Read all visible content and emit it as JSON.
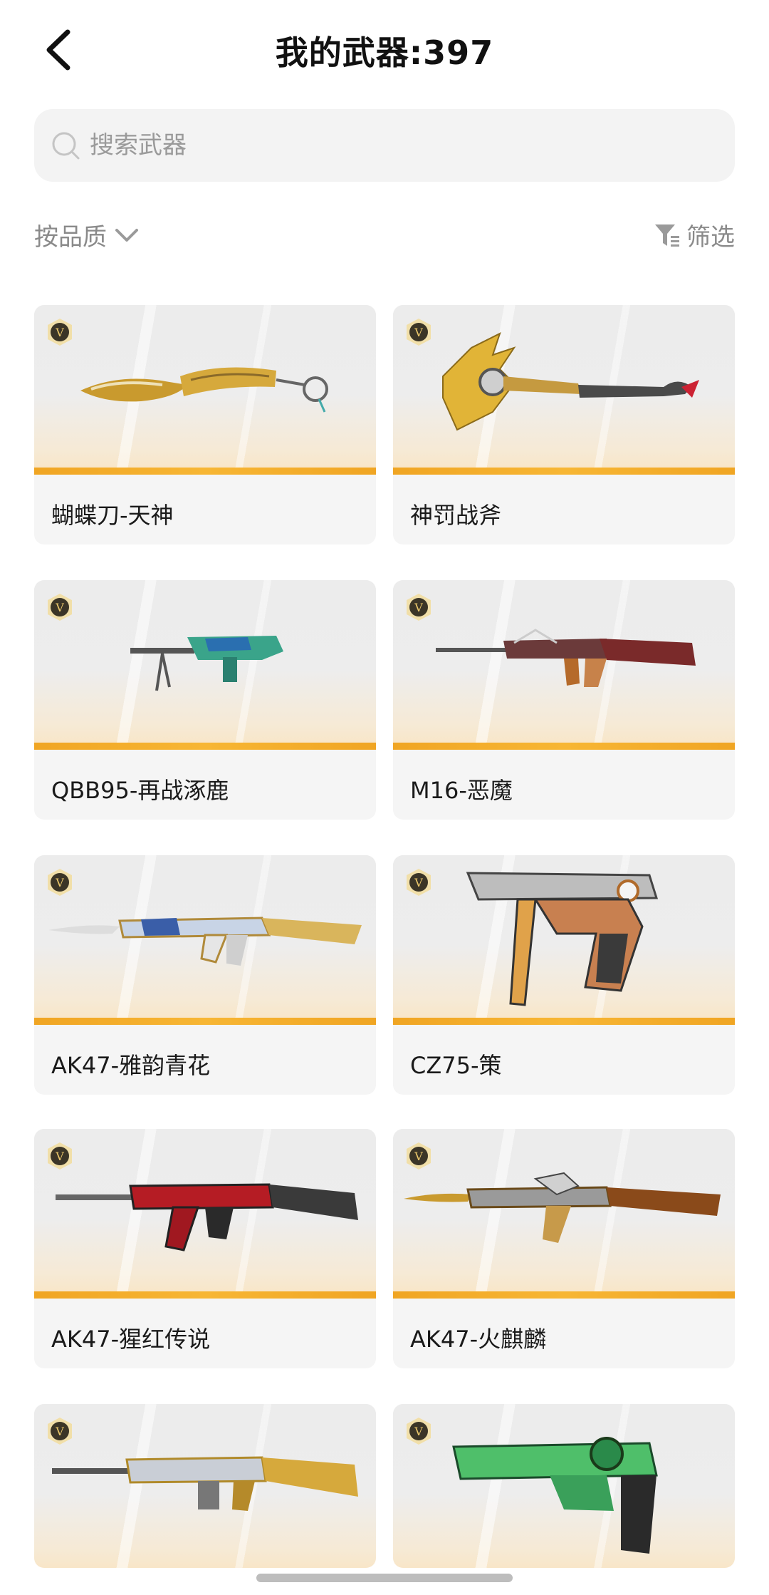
{
  "header": {
    "title": "我的武器:397"
  },
  "search": {
    "placeholder": "搜索武器"
  },
  "toolbar": {
    "sort_label": "按品质",
    "filter_label": "筛选"
  },
  "weapons": [
    {
      "name": "蝴蝶刀-天神",
      "icon": "butterfly-knife-gold"
    },
    {
      "name": "神罚战斧",
      "icon": "battle-axe-gold"
    },
    {
      "name": "QBB95-再战涿鹿",
      "icon": "machine-gun-green"
    },
    {
      "name": "M16-恶魔",
      "icon": "rifle-m16-demon"
    },
    {
      "name": "AK47-雅韵青花",
      "icon": "rifle-ak47-porcelain"
    },
    {
      "name": "CZ75-策",
      "icon": "pistol-cz75"
    },
    {
      "name": "AK47-猩红传说",
      "icon": "rifle-ak47-red"
    },
    {
      "name": "AK47-火麒麟",
      "icon": "rifle-ak47-qilin"
    },
    {
      "name": "",
      "icon": "rifle-gold-silver"
    },
    {
      "name": "",
      "icon": "pistol-green"
    }
  ],
  "colors": {
    "quality_bar": "#f0a523",
    "search_bg": "#f3f3f3",
    "card_bg": "#f5f5f5"
  }
}
